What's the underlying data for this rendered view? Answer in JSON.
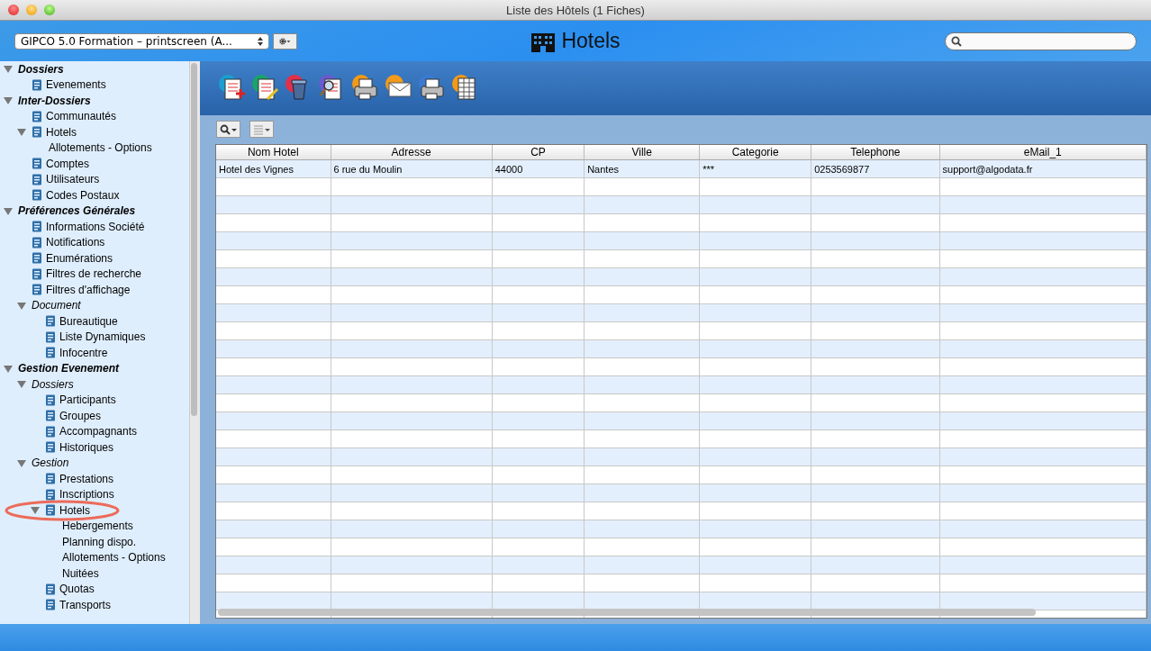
{
  "window": {
    "title": "Liste des Hôtels (1 Fiches)"
  },
  "header": {
    "database_select": "GIPCO 5.0 Formation – printscreen (A...",
    "title": "Hotels"
  },
  "sidebar": {
    "items": [
      {
        "label": "Dossiers",
        "kind": "section",
        "expanded": true,
        "children": [
          {
            "label": "Evenements",
            "kind": "item"
          }
        ]
      },
      {
        "label": "Inter-Dossiers",
        "kind": "section",
        "expanded": true,
        "children": [
          {
            "label": "Communautés",
            "kind": "item"
          },
          {
            "label": "Hotels",
            "kind": "item",
            "expanded": true,
            "children": [
              {
                "label": "Allotements - Options",
                "kind": "leaf"
              }
            ]
          },
          {
            "label": "Comptes",
            "kind": "item"
          },
          {
            "label": "Utilisateurs",
            "kind": "item"
          },
          {
            "label": "Codes Postaux",
            "kind": "item"
          }
        ]
      },
      {
        "label": "Préférences Générales",
        "kind": "section",
        "expanded": true,
        "children": [
          {
            "label": "Informations Société",
            "kind": "item"
          },
          {
            "label": "Notifications",
            "kind": "item"
          },
          {
            "label": "Enumérations",
            "kind": "item"
          },
          {
            "label": "Filtres de recherche",
            "kind": "item"
          },
          {
            "label": "Filtres d'affichage",
            "kind": "item"
          },
          {
            "label": "Document",
            "kind": "group",
            "expanded": true,
            "children": [
              {
                "label": "Bureautique",
                "kind": "item"
              },
              {
                "label": "Liste Dynamiques",
                "kind": "item"
              },
              {
                "label": "Infocentre",
                "kind": "item"
              }
            ]
          }
        ]
      },
      {
        "label": "Gestion Evenement",
        "kind": "section",
        "expanded": true,
        "children": [
          {
            "label": "Dossiers",
            "kind": "group",
            "expanded": true,
            "children": [
              {
                "label": "Participants",
                "kind": "item"
              },
              {
                "label": "Groupes",
                "kind": "item"
              },
              {
                "label": "Accompagnants",
                "kind": "item"
              },
              {
                "label": "Historiques",
                "kind": "item"
              }
            ]
          },
          {
            "label": "Gestion",
            "kind": "group",
            "expanded": true,
            "children": [
              {
                "label": "Prestations",
                "kind": "item"
              },
              {
                "label": "Inscriptions",
                "kind": "item"
              },
              {
                "label": "Hotels",
                "kind": "item",
                "expanded": true,
                "circled": true,
                "children": [
                  {
                    "label": "Hebergements",
                    "kind": "leaf"
                  },
                  {
                    "label": "Planning dispo.",
                    "kind": "leaf"
                  },
                  {
                    "label": "Allotements - Options",
                    "kind": "leaf"
                  },
                  {
                    "label": "Nuitées",
                    "kind": "leaf"
                  }
                ]
              },
              {
                "label": "Quotas",
                "kind": "item"
              },
              {
                "label": "Transports",
                "kind": "item"
              }
            ]
          }
        ]
      }
    ]
  },
  "table": {
    "columns": [
      "Nom Hotel",
      "Adresse",
      "CP",
      "Ville",
      "Categorie",
      "Telephone",
      "eMail_1"
    ],
    "rows": [
      [
        "Hotel des Vignes",
        "6 rue du Moulin",
        "44000",
        "Nantes",
        "***",
        "0253569877",
        "support@algodata.fr"
      ]
    ]
  }
}
